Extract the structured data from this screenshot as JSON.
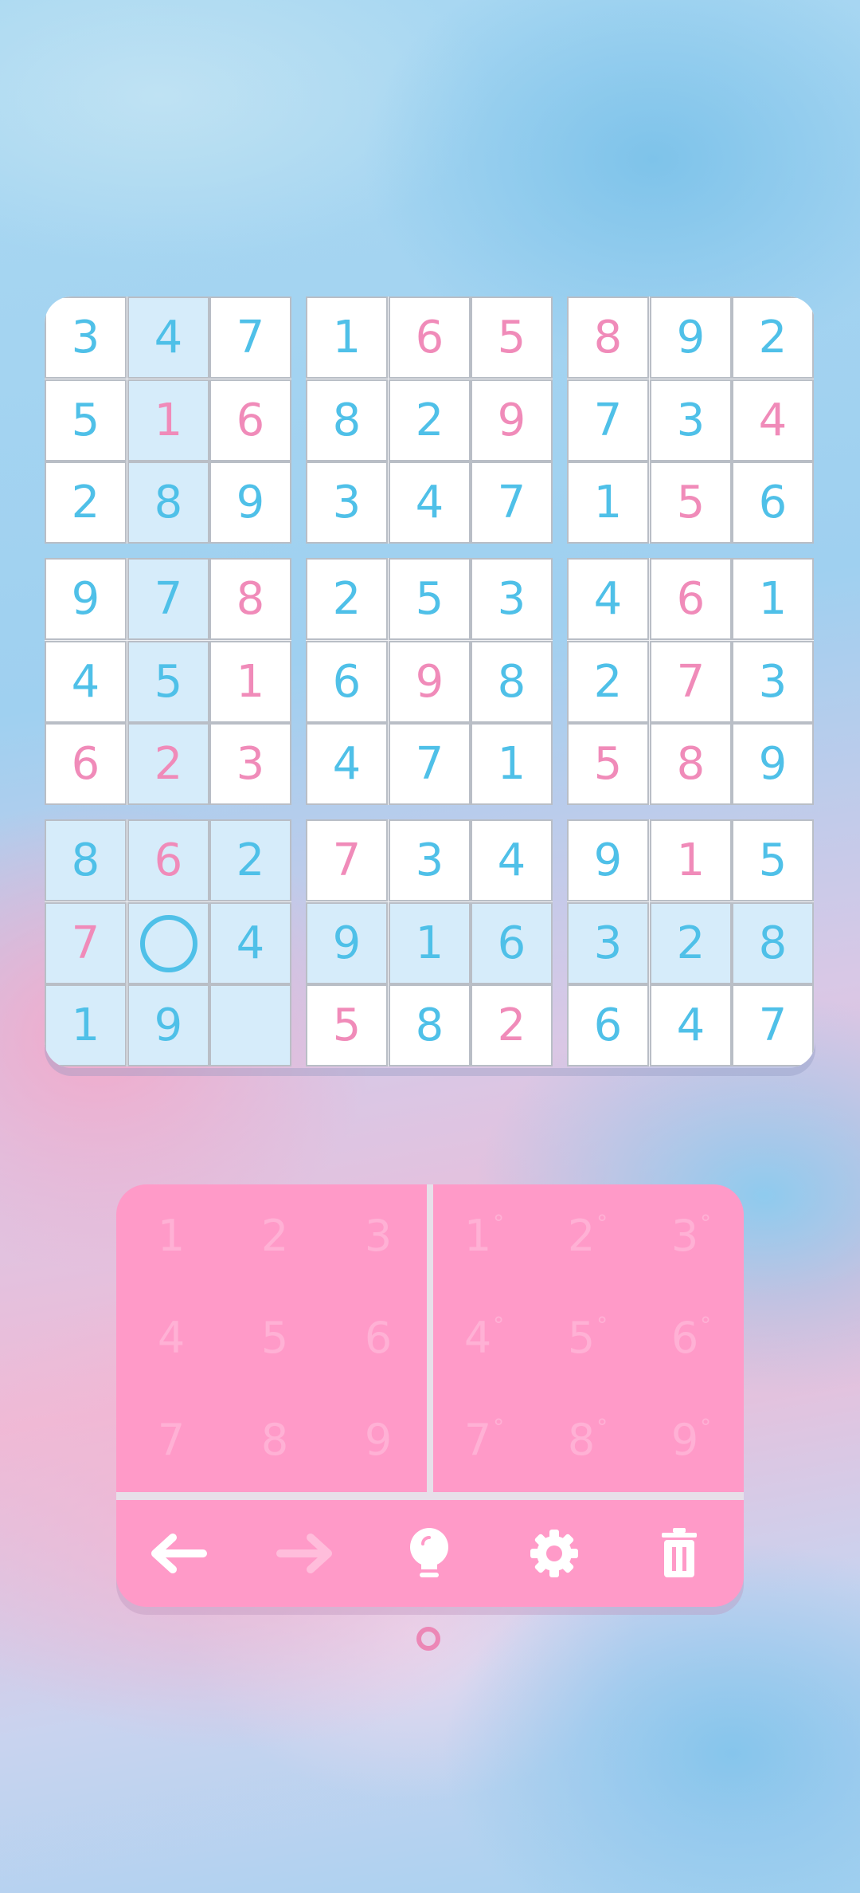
{
  "board": {
    "rows": [
      [
        "3",
        "4",
        "7",
        "1",
        "6",
        "5",
        "8",
        "9",
        "2"
      ],
      [
        "5",
        "1",
        "6",
        "8",
        "2",
        "9",
        "7",
        "3",
        "4"
      ],
      [
        "2",
        "8",
        "9",
        "3",
        "4",
        "7",
        "1",
        "5",
        "6"
      ],
      [
        "9",
        "7",
        "8",
        "2",
        "5",
        "3",
        "4",
        "6",
        "1"
      ],
      [
        "4",
        "5",
        "1",
        "6",
        "9",
        "8",
        "2",
        "7",
        "3"
      ],
      [
        "6",
        "2",
        "3",
        "4",
        "7",
        "1",
        "5",
        "8",
        "9"
      ],
      [
        "8",
        "6",
        "2",
        "7",
        "3",
        "4",
        "9",
        "1",
        "5"
      ],
      [
        "7",
        "",
        "4",
        "9",
        "1",
        "6",
        "3",
        "2",
        "8"
      ],
      [
        "1",
        "9",
        "",
        "5",
        "8",
        "2",
        "6",
        "4",
        "7"
      ]
    ],
    "user_entered": [
      [
        0,
        0,
        0,
        0,
        1,
        1,
        1,
        0,
        0
      ],
      [
        0,
        1,
        1,
        0,
        0,
        1,
        0,
        0,
        1
      ],
      [
        0,
        0,
        0,
        0,
        0,
        0,
        0,
        1,
        0
      ],
      [
        0,
        0,
        1,
        0,
        0,
        0,
        0,
        1,
        0
      ],
      [
        0,
        0,
        1,
        0,
        1,
        0,
        0,
        1,
        0
      ],
      [
        1,
        1,
        1,
        0,
        0,
        0,
        1,
        1,
        0
      ],
      [
        0,
        1,
        0,
        1,
        0,
        0,
        0,
        1,
        0
      ],
      [
        1,
        0,
        0,
        0,
        0,
        0,
        0,
        0,
        0
      ],
      [
        0,
        0,
        0,
        1,
        0,
        1,
        0,
        0,
        0
      ]
    ],
    "selected": {
      "row": 7,
      "col": 1
    },
    "colors": {
      "given": "#4fc0e8",
      "user": "#f08bb9",
      "highlight": "#d6ecfa"
    }
  },
  "numpad": {
    "values": [
      "1",
      "2",
      "3",
      "4",
      "5",
      "6",
      "7",
      "8",
      "9"
    ],
    "notes_marker": "°"
  },
  "toolbar": {
    "items": [
      {
        "name": "undo",
        "icon": "arrow-left-icon"
      },
      {
        "name": "redo",
        "icon": "arrow-right-icon"
      },
      {
        "name": "hint",
        "icon": "lightbulb-icon"
      },
      {
        "name": "settings",
        "icon": "gear-icon"
      },
      {
        "name": "delete",
        "icon": "trash-icon"
      }
    ]
  }
}
